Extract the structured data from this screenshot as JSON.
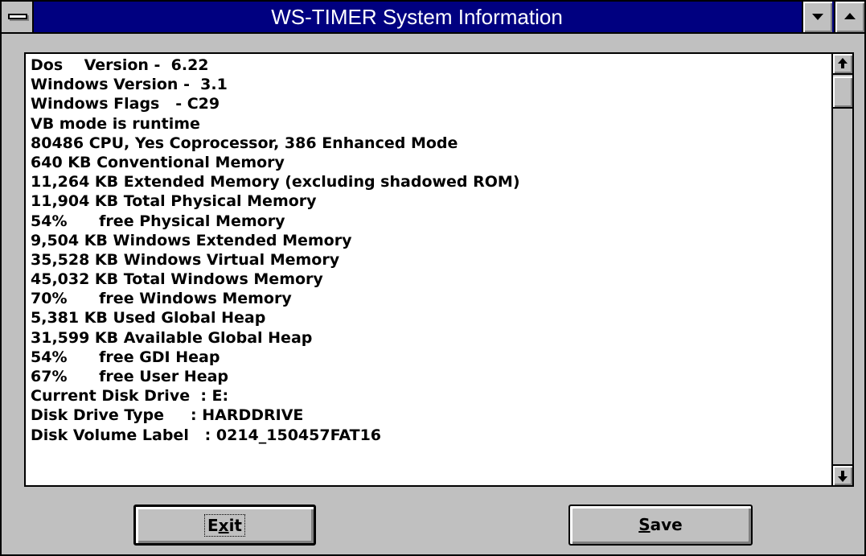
{
  "window": {
    "title": "WS-TIMER System Information"
  },
  "titlebar": {
    "icons": [
      "control-menu-icon",
      "minimize-icon",
      "maximize-icon"
    ]
  },
  "info": {
    "lines": [
      "Dos    Version -  6.22",
      "Windows Version -  3.1",
      "Windows Flags   - C29",
      "VB mode is runtime",
      "80486 CPU, Yes Coprocessor, 386 Enhanced Mode",
      "640 KB Conventional Memory",
      "11,264 KB Extended Memory (excluding shadowed ROM)",
      "11,904 KB Total Physical Memory",
      "54%      free Physical Memory",
      "9,504 KB Windows Extended Memory",
      "35,528 KB Windows Virtual Memory",
      "45,032 KB Total Windows Memory",
      "70%      free Windows Memory",
      "5,381 KB Used Global Heap",
      "31,599 KB Available Global Heap",
      "54%      free GDI Heap",
      "67%      free User Heap",
      "Current Disk Drive  : E:",
      "Disk Drive Type     : HARDDRIVE",
      "Disk Volume Label   : 0214_150457FAT16"
    ]
  },
  "scrollbar": {
    "up_icon": "scroll-up-arrow-icon",
    "down_icon": "scroll-down-arrow-icon",
    "position": 0
  },
  "buttons": {
    "exit": {
      "pre": "E",
      "accel": "x",
      "post": "it"
    },
    "save": {
      "pre": "",
      "accel": "S",
      "post": "ave"
    }
  },
  "colors": {
    "titlebar": "#000080",
    "face": "#c0c0c0",
    "list_bg": "#ffffff"
  }
}
